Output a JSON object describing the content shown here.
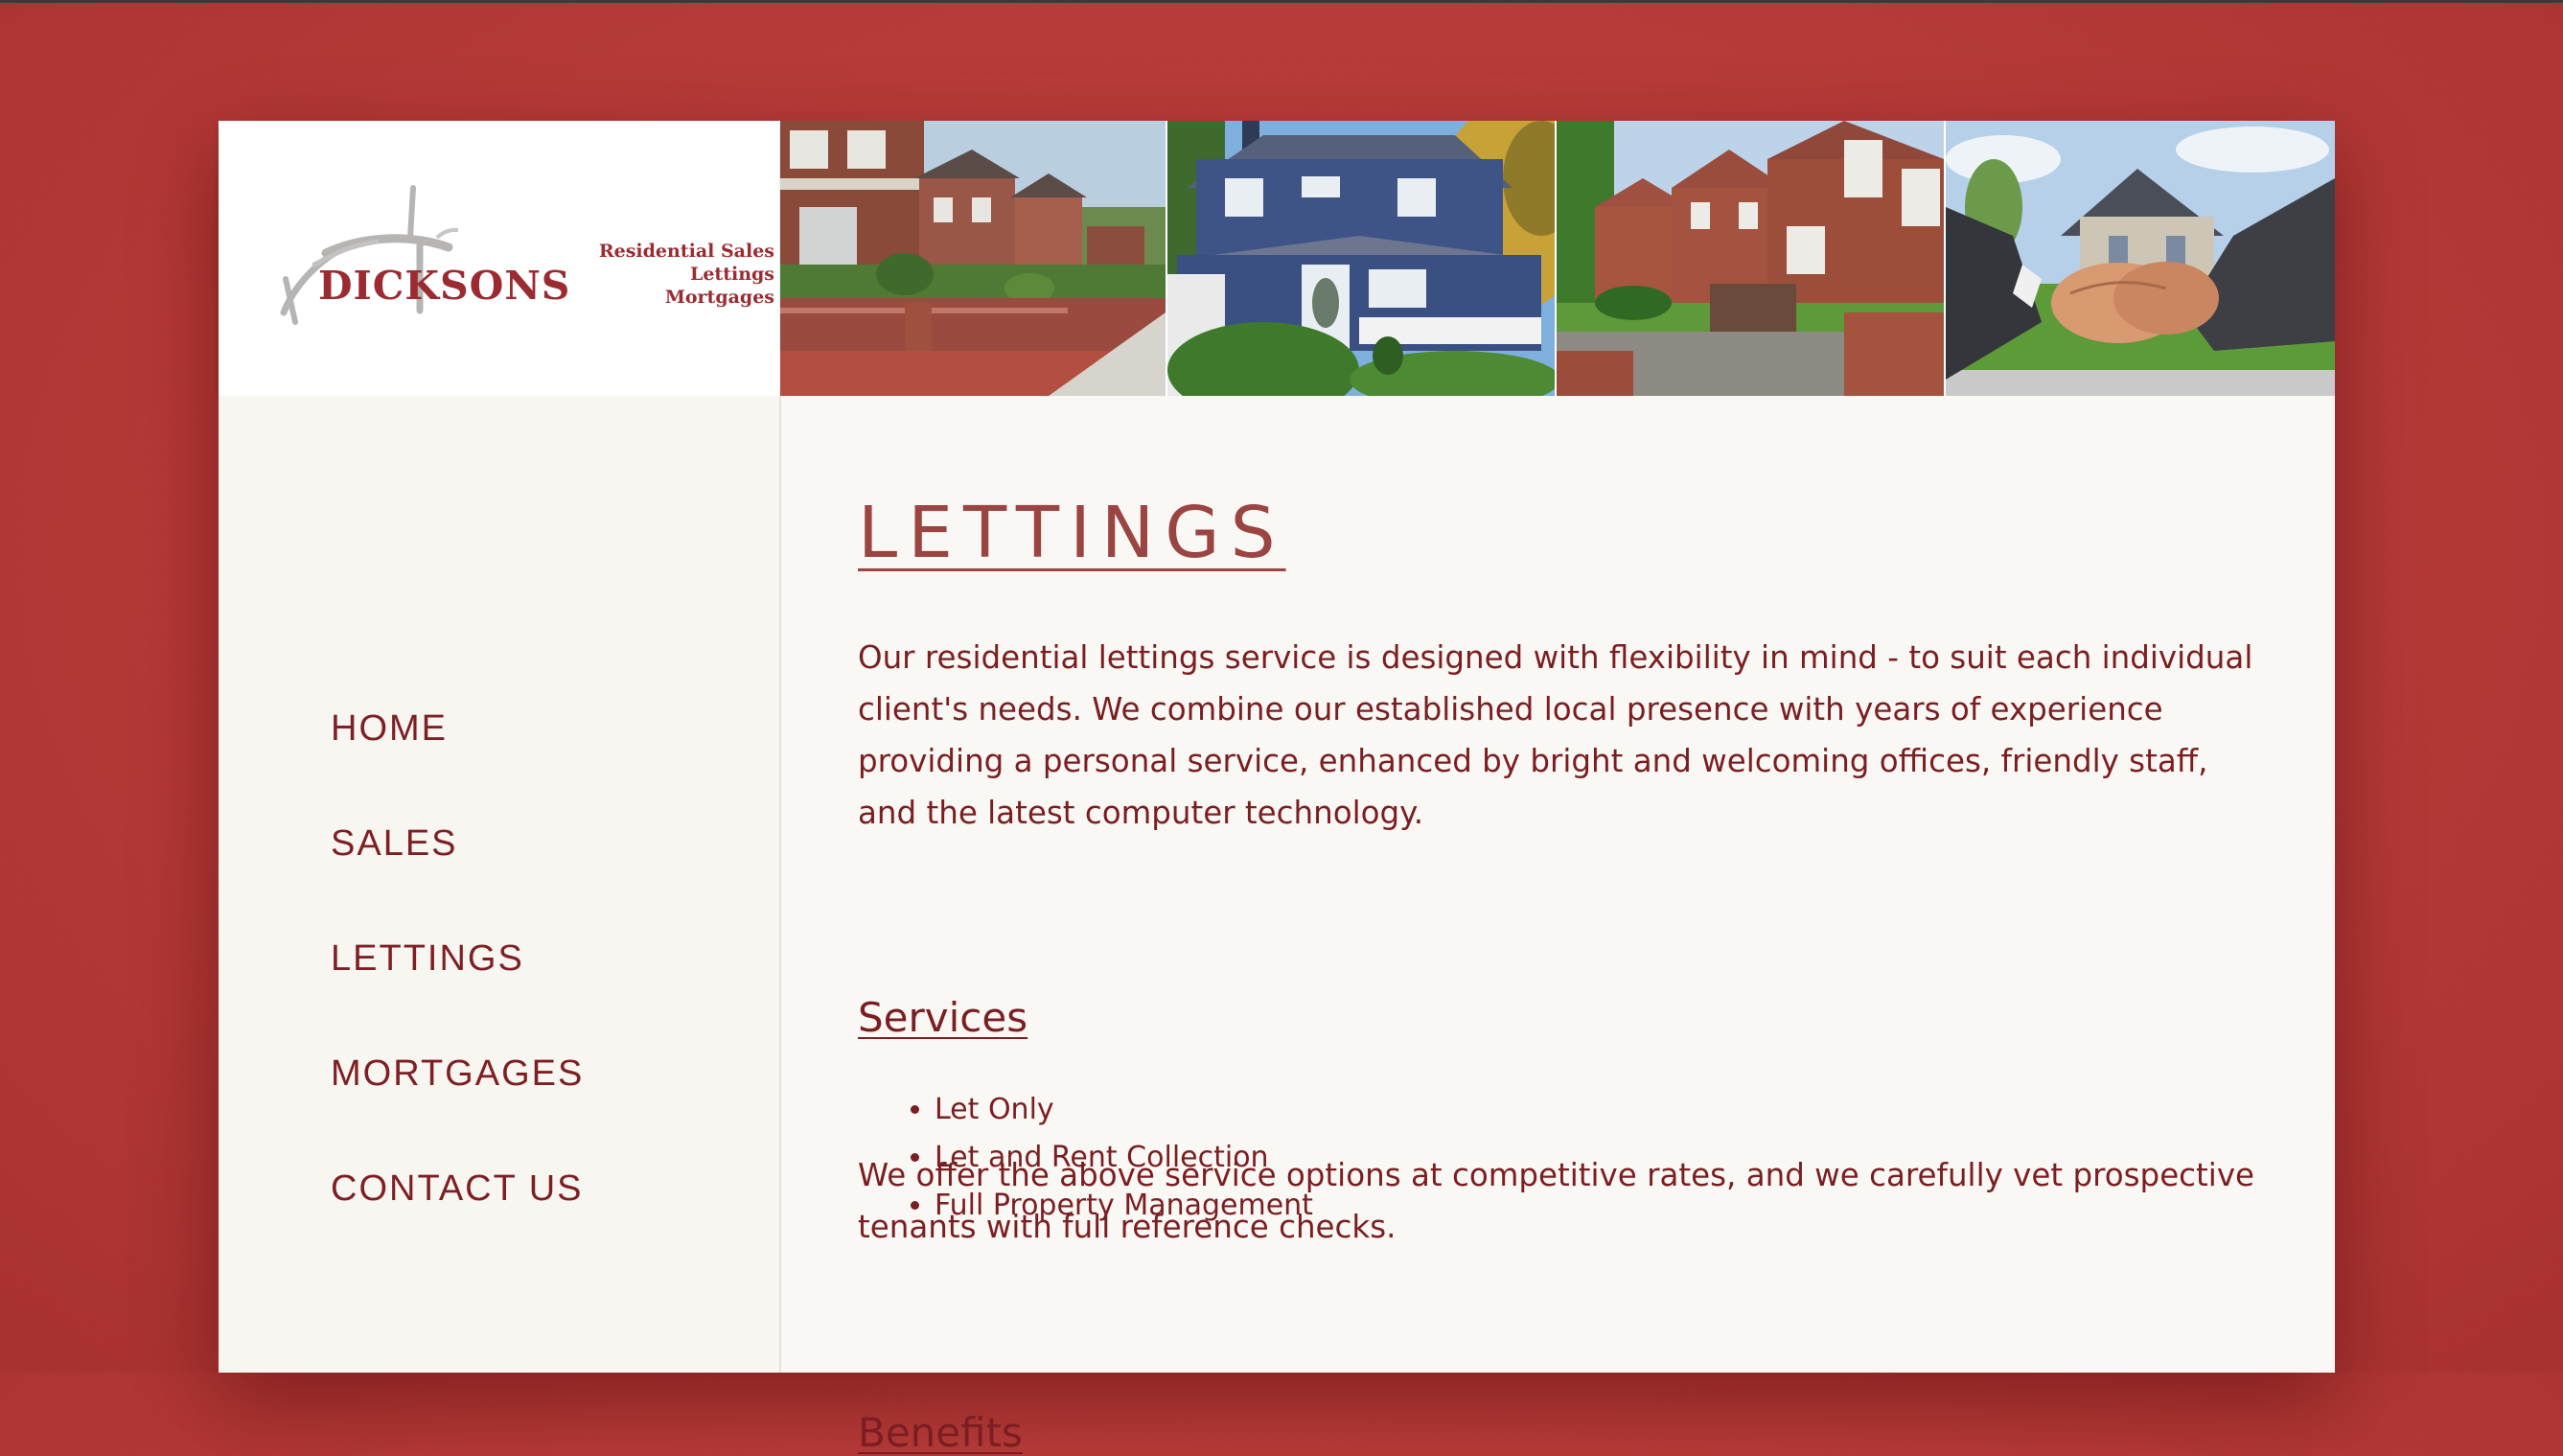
{
  "logo": {
    "name": "DICKSONS",
    "tagline": [
      "Residential Sales",
      "Lettings",
      "Mortgages"
    ]
  },
  "header_photos": [
    "brick-houses-street-photo",
    "blue-house-photo",
    "brick-row-houses-photo",
    "handshake-house-photo"
  ],
  "nav": {
    "items": [
      {
        "label": "HOME"
      },
      {
        "label": "SALES"
      },
      {
        "label": "LETTINGS"
      },
      {
        "label": "MORTGAGES"
      },
      {
        "label": "CONTACT US"
      }
    ]
  },
  "main": {
    "title": "LETTINGS",
    "intro": "Our residential lettings service is designed with flexibility in mind - to suit each individual client's needs. We combine our established local presence with years of experience providing a personal service, enhanced by bright and welcoming offices, friendly staff, and the latest computer technology.",
    "services_heading": "Services",
    "services": [
      "Let Only",
      "Let and Rent Collection",
      "Full Property Management"
    ],
    "rates_text": "We offer the above service options at competitive rates, and we carefully vet prospective tenants with full reference checks.",
    "benefits_heading": "Benefits"
  },
  "colors": {
    "background": "#b53a38",
    "accent": "#7b1e22",
    "title": "#9b4543",
    "panel": "#faf8f4"
  }
}
